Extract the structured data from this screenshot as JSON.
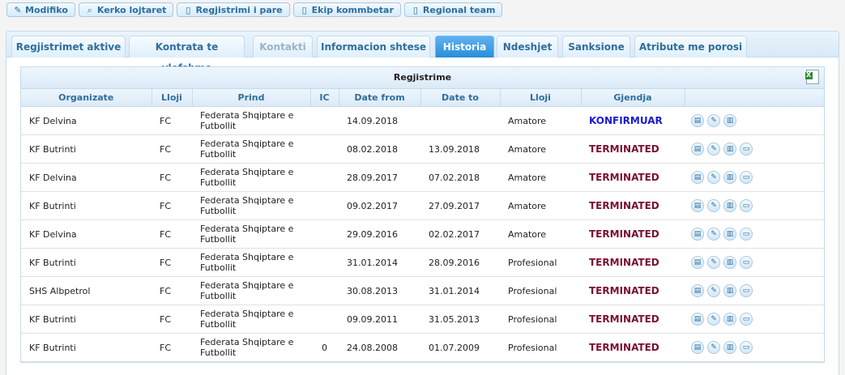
{
  "toolbar": {
    "buttons": [
      {
        "label": "Modifiko",
        "icon": "pencil-icon",
        "glyph": "✎"
      },
      {
        "label": "Kerko lojtaret",
        "icon": "search-icon",
        "glyph": "⌕"
      },
      {
        "label": "Regjistrimi i pare",
        "icon": "document-icon",
        "glyph": "▯"
      },
      {
        "label": "Ekip kommbetar",
        "icon": "document-icon",
        "glyph": "▯"
      },
      {
        "label": "Regional team",
        "icon": "document-icon",
        "glyph": "▯"
      }
    ]
  },
  "tabs": [
    {
      "label": "Regjistrimet aktive",
      "state": "normal"
    },
    {
      "label": "Kontrata te vlefshme",
      "state": "normal"
    },
    {
      "label": "Kontakti",
      "state": "disabled"
    },
    {
      "label": "Informacion shtese",
      "state": "normal"
    },
    {
      "label": "Historia",
      "state": "active"
    },
    {
      "label": "Ndeshjet",
      "state": "normal"
    },
    {
      "label": "Sanksione",
      "state": "normal"
    },
    {
      "label": "Atribute me porosi",
      "state": "normal"
    }
  ],
  "grid": {
    "caption": "Regjistrime",
    "export_icon": "excel-export-icon",
    "columns": [
      "Organizate",
      "Lloji",
      "Prind",
      "IC",
      "Date from",
      "Date to",
      "Lloji",
      "Gjendja",
      ""
    ],
    "rows": [
      {
        "org": "KF Delvina",
        "type": "FC",
        "parent": "Federata Shqiptare e Futbollit",
        "ic": "",
        "from": "14.09.2018",
        "to": "",
        "kind": "Amatore",
        "status": "KONFIRMUAR",
        "status_kind": "confirmed",
        "printable": false
      },
      {
        "org": "KF Butrinti",
        "type": "FC",
        "parent": "Federata Shqiptare e Futbollit",
        "ic": "",
        "from": "08.02.2018",
        "to": "13.09.2018",
        "kind": "Amatore",
        "status": "TERMINATED",
        "status_kind": "terminated",
        "printable": true
      },
      {
        "org": "KF Delvina",
        "type": "FC",
        "parent": "Federata Shqiptare e Futbollit",
        "ic": "",
        "from": "28.09.2017",
        "to": "07.02.2018",
        "kind": "Amatore",
        "status": "TERMINATED",
        "status_kind": "terminated",
        "printable": true
      },
      {
        "org": "KF Butrinti",
        "type": "FC",
        "parent": "Federata Shqiptare e Futbollit",
        "ic": "",
        "from": "09.02.2017",
        "to": "27.09.2017",
        "kind": "Amatore",
        "status": "TERMINATED",
        "status_kind": "terminated",
        "printable": true
      },
      {
        "org": "KF Delvina",
        "type": "FC",
        "parent": "Federata Shqiptare e Futbollit",
        "ic": "",
        "from": "29.09.2016",
        "to": "02.02.2017",
        "kind": "Amatore",
        "status": "TERMINATED",
        "status_kind": "terminated",
        "printable": true
      },
      {
        "org": "KF Butrinti",
        "type": "FC",
        "parent": "Federata Shqiptare e Futbollit",
        "ic": "",
        "from": "31.01.2014",
        "to": "28.09.2016",
        "kind": "Profesional",
        "status": "TERMINATED",
        "status_kind": "terminated",
        "printable": true
      },
      {
        "org": "SHS Albpetrol",
        "type": "FC",
        "parent": "Federata Shqiptare e Futbollit",
        "ic": "",
        "from": "30.08.2013",
        "to": "31.01.2014",
        "kind": "Profesional",
        "status": "TERMINATED",
        "status_kind": "terminated",
        "printable": true
      },
      {
        "org": "KF Butrinti",
        "type": "FC",
        "parent": "Federata Shqiptare e Futbollit",
        "ic": "",
        "from": "09.09.2011",
        "to": "31.05.2013",
        "kind": "Profesional",
        "status": "TERMINATED",
        "status_kind": "terminated",
        "printable": true
      },
      {
        "org": "KF Butrinti",
        "type": "FC",
        "parent": "Federata Shqiptare e Futbollit",
        "ic": "0",
        "from": "24.08.2008",
        "to": "01.07.2009",
        "kind": "Profesional",
        "status": "TERMINATED",
        "status_kind": "terminated",
        "printable": true
      }
    ],
    "row_actions": [
      {
        "icon": "clipboard-icon",
        "glyph": "▤"
      },
      {
        "icon": "pencil-icon",
        "glyph": "✎"
      },
      {
        "icon": "trash-icon",
        "glyph": "▥"
      },
      {
        "icon": "print-icon",
        "glyph": "▭"
      }
    ]
  },
  "colors": {
    "confirmed": "#1a1ad0",
    "terminated": "#7a1030",
    "active_tab": "#2a8fd8",
    "header_text": "#2e6e9e"
  }
}
